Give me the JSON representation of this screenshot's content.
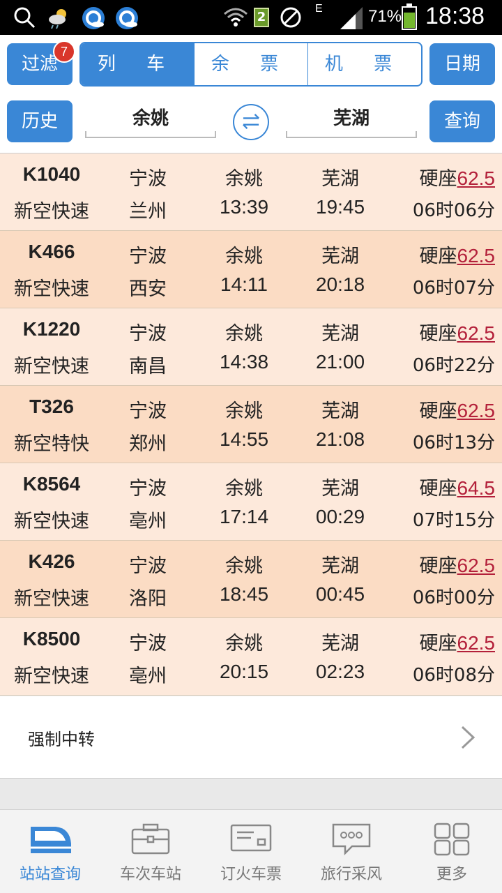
{
  "status_bar": {
    "battery": "71%",
    "time": "18:38",
    "sim_number": "2",
    "network": "E"
  },
  "toolbar": {
    "filter_label": "过滤",
    "filter_badge": "7",
    "tabs": [
      {
        "label": "列 车",
        "active": true
      },
      {
        "label": "余 票",
        "active": false
      },
      {
        "label": "机 票",
        "active": false
      }
    ],
    "date_label": "日期",
    "history_label": "历史",
    "from_station": "余姚",
    "to_station": "芜湖",
    "query_label": "查询"
  },
  "trains": [
    {
      "no": "K1040",
      "type": "新空快速",
      "origin": "宁波",
      "dest": "兰州",
      "board": "余姚",
      "depart": "13:39",
      "alight": "芜湖",
      "arrive": "19:45",
      "seat": "硬座",
      "price": "62.5",
      "duration": "06时06分"
    },
    {
      "no": "K466",
      "type": "新空快速",
      "origin": "宁波",
      "dest": "西安",
      "board": "余姚",
      "depart": "14:11",
      "alight": "芜湖",
      "arrive": "20:18",
      "seat": "硬座",
      "price": "62.5",
      "duration": "06时07分"
    },
    {
      "no": "K1220",
      "type": "新空快速",
      "origin": "宁波",
      "dest": "南昌",
      "board": "余姚",
      "depart": "14:38",
      "alight": "芜湖",
      "arrive": "21:00",
      "seat": "硬座",
      "price": "62.5",
      "duration": "06时22分"
    },
    {
      "no": "T326",
      "type": "新空特快",
      "origin": "宁波",
      "dest": "郑州",
      "board": "余姚",
      "depart": "14:55",
      "alight": "芜湖",
      "arrive": "21:08",
      "seat": "硬座",
      "price": "62.5",
      "duration": "06时13分"
    },
    {
      "no": "K8564",
      "type": "新空快速",
      "origin": "宁波",
      "dest": "亳州",
      "board": "余姚",
      "depart": "17:14",
      "alight": "芜湖",
      "arrive": "00:29",
      "seat": "硬座",
      "price": "64.5",
      "duration": "07时15分"
    },
    {
      "no": "K426",
      "type": "新空快速",
      "origin": "宁波",
      "dest": "洛阳",
      "board": "余姚",
      "depart": "18:45",
      "alight": "芜湖",
      "arrive": "00:45",
      "seat": "硬座",
      "price": "62.5",
      "duration": "06时00分"
    },
    {
      "no": "K8500",
      "type": "新空快速",
      "origin": "宁波",
      "dest": "亳州",
      "board": "余姚",
      "depart": "20:15",
      "alight": "芜湖",
      "arrive": "02:23",
      "seat": "硬座",
      "price": "62.5",
      "duration": "06时08分"
    }
  ],
  "transfer": {
    "label": "强制中转"
  },
  "bottom_nav": [
    {
      "label": "站站查询",
      "icon": "train-icon",
      "active": true
    },
    {
      "label": "车次车站",
      "icon": "briefcase-icon",
      "active": false
    },
    {
      "label": "订火车票",
      "icon": "ticket-icon",
      "active": false
    },
    {
      "label": "旅行采风",
      "icon": "chat-bubble-icon",
      "active": false
    },
    {
      "label": "更多",
      "icon": "grid-icon",
      "active": false
    }
  ],
  "colors": {
    "accent": "#3a87d6",
    "row_light": "#fde9db",
    "row_dark": "#fbdcc4",
    "price": "#b3203a",
    "badge": "#d9362b"
  }
}
